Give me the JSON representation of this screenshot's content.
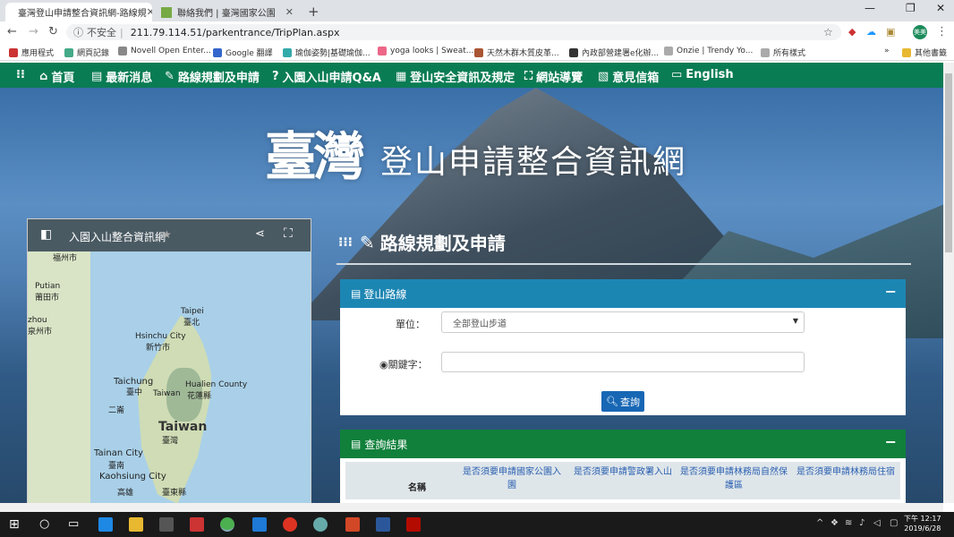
{
  "browser": {
    "tabs": [
      {
        "title": "臺灣登山申請整合資訊網-路線規",
        "active": true
      },
      {
        "title": "聯絡我們 | 臺灣國家公園",
        "active": false
      }
    ],
    "security_label": "不安全",
    "url": "211.79.114.51/parkentrance/TripPlan.aspx",
    "bookmarks": [
      "應用程式",
      "網頁記錄",
      "Novell Open Enter...",
      "Google 翻譯",
      "瑜伽姿勢|基礎瑜伽...",
      "yoga looks | Sweat...",
      "天然木群木質皮革...",
      "內政部營建署e化辦...",
      "Onzie | Trendy Yo...",
      "所有樣式"
    ],
    "other_bookmarks": "其他書籤",
    "profile": "美美"
  },
  "site_nav": {
    "items": [
      "首頁",
      "最新消息",
      "路線規劃及申請",
      "入園入山申請Q&A",
      "登山安全資訊及規定",
      "網站導覽",
      "意見信箱",
      "English"
    ]
  },
  "hero": {
    "logo_big": "臺灣",
    "logo_text": "登山申請整合資訊網"
  },
  "map_panel": {
    "title": "入園入山整合資訊網",
    "labels": [
      "福州市",
      "Putian",
      "莆田市",
      "zhou",
      "泉州市",
      "Taipei",
      "臺北",
      "Hsinchu City",
      "新竹市",
      "Taichung",
      "臺中",
      "Taiwan",
      "Hualien County",
      "花蓮縣",
      "Taiwan",
      "臺灣",
      "二崙",
      "Tainan City",
      "臺南",
      "Kaohsiung City",
      "高雄",
      "臺東縣"
    ]
  },
  "section": {
    "title": "路線規劃及申請"
  },
  "route_card": {
    "header": "登山路線",
    "unit_label": "單位：",
    "unit_value": "全部登山步道",
    "keyword_label": "關鍵字：",
    "search_button": "查詢"
  },
  "results_card": {
    "header": "查詢結果",
    "columns": [
      "名稱",
      "是否須要申請國家公園入園",
      "是否須要申請警政署入山",
      "是否須要申請林務局自然保護區",
      "是否須要申請林務局住宿"
    ]
  },
  "taskbar": {
    "time": "下午 12:17",
    "date": "2019/6/28"
  }
}
